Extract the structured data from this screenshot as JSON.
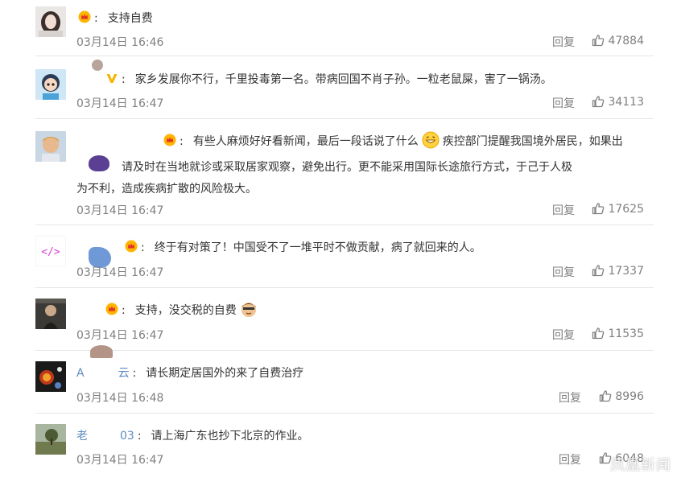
{
  "comments": [
    {
      "user": "",
      "text": "支持自费",
      "time": "03月14日 16:46",
      "reply_label": "回复",
      "likes": "47884"
    },
    {
      "user": "",
      "text": "家乡发展你不行，千里投毒第一名。带病回国不肖子孙。一粒老鼠屎，害了一锅汤。",
      "time": "03月14日 16:47",
      "reply_label": "回复",
      "likes": "34113"
    },
    {
      "user": "",
      "text_before_emoji": "有些人麻烦好好看新闻，最后一段话说了什么",
      "text_after_emoji": "疾控部门提醒我国境外居民，如果出",
      "text_line2": "请及时在当地就诊或采取居家观察，避免出行。更不能采用国际长途旅行方式，于己于人极",
      "text_line3": "为不利，造成疾病扩散的风险极大。",
      "time": "03月14日 16:47",
      "reply_label": "回复",
      "likes": "17625"
    },
    {
      "user": "",
      "text": "终于有对策了！中国受不了一堆平时不做贡献，病了就回来的人。",
      "time": "03月14日 16:47",
      "reply_label": "回复",
      "likes": "17337"
    },
    {
      "user": "",
      "text": "支持，没交税的自费",
      "time": "03月14日 16:47",
      "reply_label": "回复",
      "likes": "11535"
    },
    {
      "user": "A",
      "text": "请长期定居国外的来了自费治疗",
      "time": "03月14日 16:48",
      "reply_label": "回复",
      "likes": "8996"
    },
    {
      "user": "03",
      "text": "请上海广东也抄下北京的作业。",
      "time": "03月14日 16:47",
      "reply_label": "回复",
      "likes": "6048"
    }
  ],
  "icons": {
    "like": "thumbs-up-icon",
    "badge": "crown-badge-icon",
    "vip": "vip-v-icon"
  },
  "colors": {
    "username": "#eb7350",
    "username_alt": "#5d8bbf",
    "meta": "#808080",
    "divider": "#e6e6e6"
  },
  "watermark": "凤凰新闻"
}
